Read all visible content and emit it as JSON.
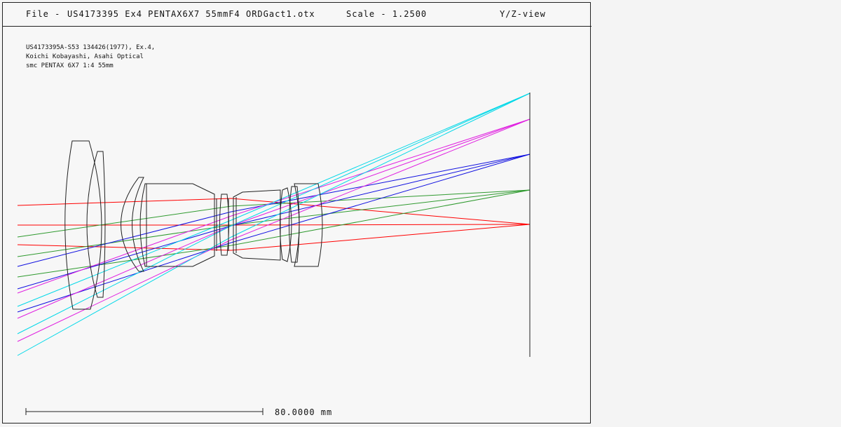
{
  "header": {
    "file_label": "File -",
    "file_name": "US4173395 Ex4 PENTAX6X7 55mmF4 ORDGact1.otx",
    "scale_label": "Scale - 1.2500",
    "view_label": "Y/Z-view"
  },
  "description": {
    "line1": "US4173395A-S53 134426(1977), Ex.4,",
    "line2": "Koichi Kobayashi, Asahi Optical",
    "line3": "smc PENTAX 6X7 1:4 55mm"
  },
  "scale_bar": {
    "label": "80.0000 mm"
  },
  "colors": {
    "background": "#f4f4f4",
    "frame": "#222222",
    "lens_outline": "#222222",
    "field_0_red": "#ff0000",
    "field_1_green": "#2f9a2f",
    "field_2_blue": "#1010e0",
    "field_3_magenta": "#e020e0",
    "field_4_cyan": "#00d8e8"
  }
}
